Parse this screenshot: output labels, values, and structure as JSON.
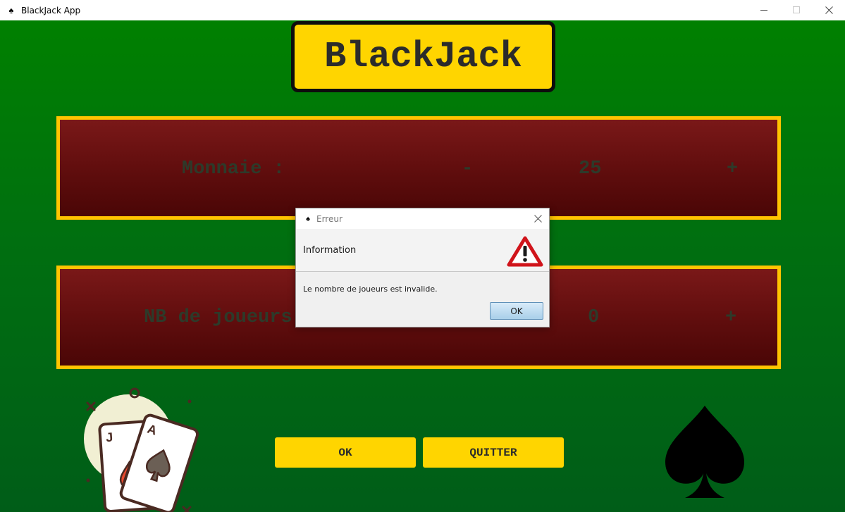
{
  "window": {
    "title": "BlackJack App",
    "icon": "spade-icon",
    "controls": [
      "minimize-icon",
      "maximize-icon",
      "close-icon"
    ]
  },
  "logo": {
    "text": "BlackJack"
  },
  "money_panel": {
    "label": "Monnaie :",
    "minus": "-",
    "value": "25",
    "plus": "+"
  },
  "players_panel": {
    "label": "NB de joueurs",
    "value": "0",
    "plus": "+"
  },
  "buttons": {
    "ok": "OK",
    "quit": "QUITTER"
  },
  "dialog": {
    "title": "Erreur",
    "header": "Information",
    "message": "Le nombre de joueurs est invalide.",
    "ok": "OK",
    "icon": "warning-icon"
  },
  "colors": {
    "felt": "#006400",
    "gold": "#ffd500",
    "panel": "#6b1010",
    "panel_border": "#ffc400"
  }
}
